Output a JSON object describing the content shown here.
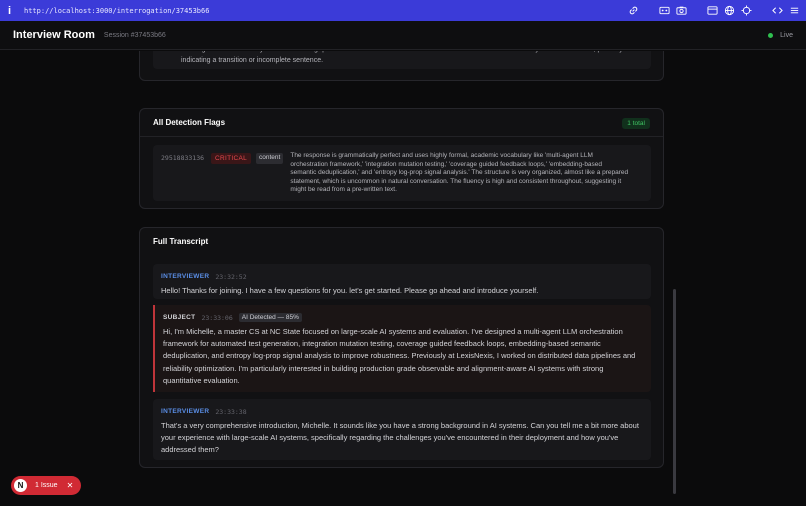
{
  "browser": {
    "url": "http://localhost:3000/interrogation/37453b66"
  },
  "header": {
    "title": "Interview Room",
    "session": "Session #37453b66",
    "status": "Live"
  },
  "summary": {
    "text": "and alignment-aware AI systems with strong quantitative evaluation. The video concludes with a brief utterance of 'you' at 40 seconds, possibly indicating a transition or incomplete sentence."
  },
  "flags": {
    "title": "All Detection Flags",
    "total": "1 total",
    "items": [
      {
        "time": "29518833136",
        "severity": "CRITICAL",
        "type": "content",
        "text": "The response is grammatically perfect and uses highly formal, academic vocabulary like 'multi-agent LLM orchestration framework,' 'integration mutation testing,' 'coverage guided feedback loops,' 'embedding-based semantic deduplication,' and 'entropy log-prop signal analysis.' The structure is very organized, almost like a prepared statement, which is uncommon in natural conversation. The fluency is high and consistent throughout, suggesting it might be read from a pre-written text."
      }
    ]
  },
  "transcript": {
    "title": "Full Transcript",
    "messages": [
      {
        "role": "INTERVIEWER",
        "time": "23:32:52",
        "text": "Hello! Thanks for joining. I have a few questions for you. let's get started. Please go ahead and introduce yourself."
      },
      {
        "role": "SUBJECT",
        "time": "23:33:06",
        "badge": "AI Detected — 85%",
        "text": "Hi, I'm Michelle, a master CS at NC State focused on large-scale AI systems and evaluation. I've designed a multi-agent LLM orchestration framework for automated test generation, integration mutation testing, coverage guided feedback loops, embedding-based semantic deduplication, and entropy log-prop signal analysis to improve robustness. Previously at LexisNexis, I worked on distributed data pipelines and reliability optimization. I'm particularly interested in building production grade observable and alignment-aware AI systems with strong quantitative evaluation."
      },
      {
        "role": "INTERVIEWER",
        "time": "23:33:38",
        "text": "That's a very comprehensive introduction, Michelle. It sounds like you have a strong background in AI systems. Can you tell me a bit more about your experience with large-scale AI systems, specifically regarding the challenges you've encountered in their deployment and how you've addressed them?"
      }
    ]
  },
  "issues": {
    "logo": "N",
    "label": "1 Issue"
  },
  "colors": {
    "accent": "#3b3bd8",
    "critical": "#e5484d",
    "live": "#2fbf4f",
    "interviewer": "#5a8ee6"
  }
}
